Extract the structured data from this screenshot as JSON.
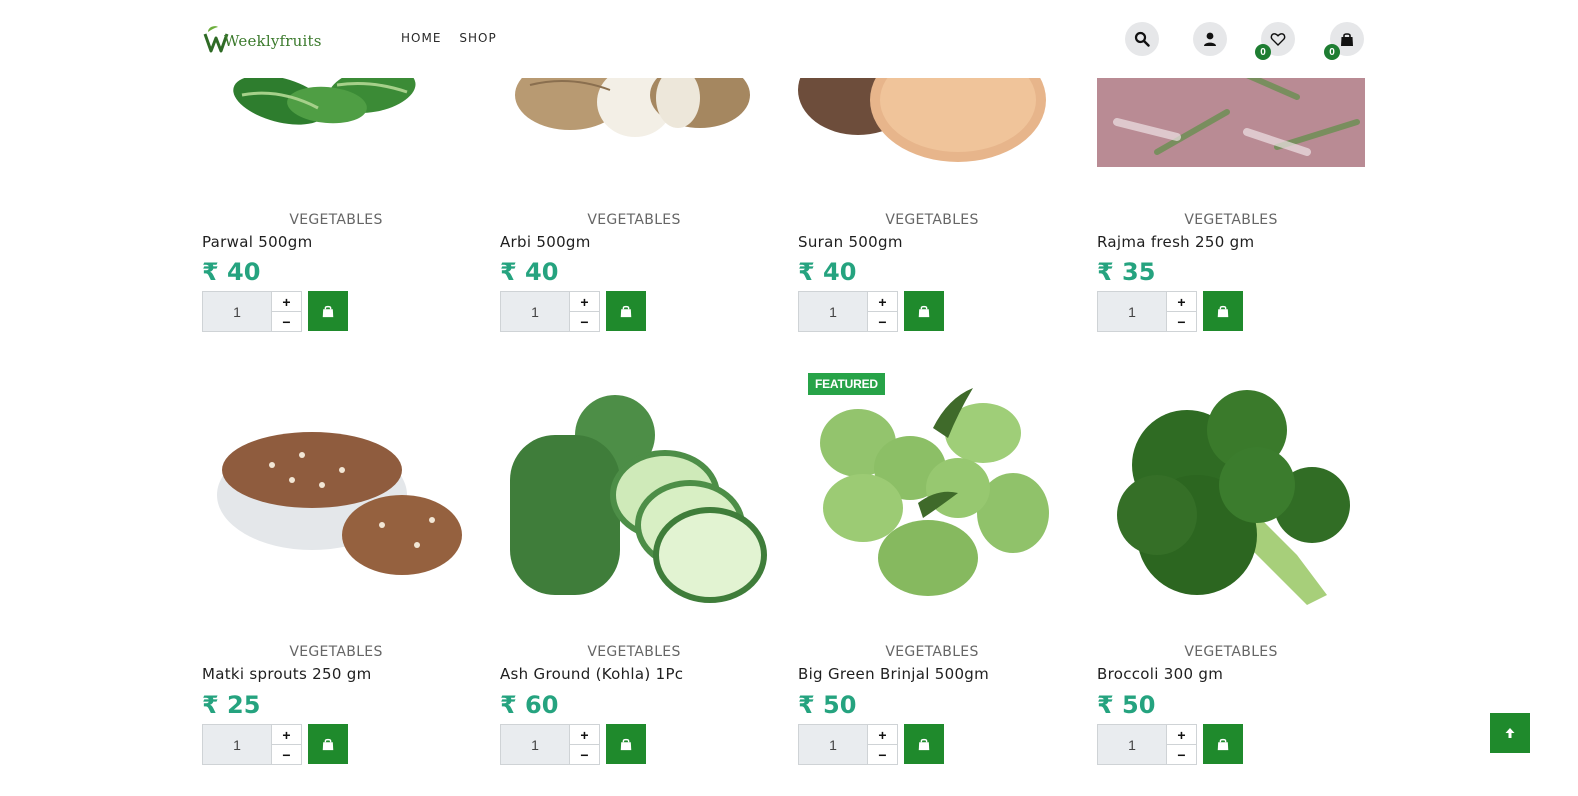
{
  "header": {
    "logo_text": "Weeklyfruits",
    "nav": [
      "HOME",
      "SHOP"
    ],
    "wishlist_count": "0",
    "cart_count": "0"
  },
  "colors": {
    "brand_green": "#1f8a2c",
    "price_teal": "#25a37f",
    "featured_green": "#27a348"
  },
  "products": [
    {
      "category": "VEGETABLES",
      "name": "Parwal 500gm",
      "price": "₹ 40",
      "qty": "1",
      "image": "pointed-gourd-image",
      "featured": false
    },
    {
      "category": "VEGETABLES",
      "name": "Arbi 500gm",
      "price": "₹ 40",
      "qty": "1",
      "image": "taro-root-image",
      "featured": false
    },
    {
      "category": "VEGETABLES",
      "name": "Suran 500gm",
      "price": "₹ 40",
      "qty": "1",
      "image": "yam-image",
      "featured": false
    },
    {
      "category": "VEGETABLES",
      "name": "Rajma fresh 250 gm",
      "price": "₹ 35",
      "qty": "1",
      "image": "fresh-beans-image",
      "featured": false
    },
    {
      "category": "VEGETABLES",
      "name": "Matki sprouts 250 gm",
      "price": "₹ 25",
      "qty": "1",
      "image": "sprouts-bowl-image",
      "featured": false
    },
    {
      "category": "VEGETABLES",
      "name": "Ash Ground (Kohla) 1Pc",
      "price": "₹ 60",
      "qty": "1",
      "image": "ash-gourd-image",
      "featured": false
    },
    {
      "category": "VEGETABLES",
      "name": "Big Green Brinjal 500gm",
      "price": "₹ 50",
      "qty": "1",
      "image": "green-brinjal-image",
      "featured": true,
      "badge": "FEATURED"
    },
    {
      "category": "VEGETABLES",
      "name": "Broccoli 300 gm",
      "price": "₹ 50",
      "qty": "1",
      "image": "broccoli-image",
      "featured": false
    }
  ],
  "steppers": {
    "plus": "+",
    "minus": "−"
  }
}
